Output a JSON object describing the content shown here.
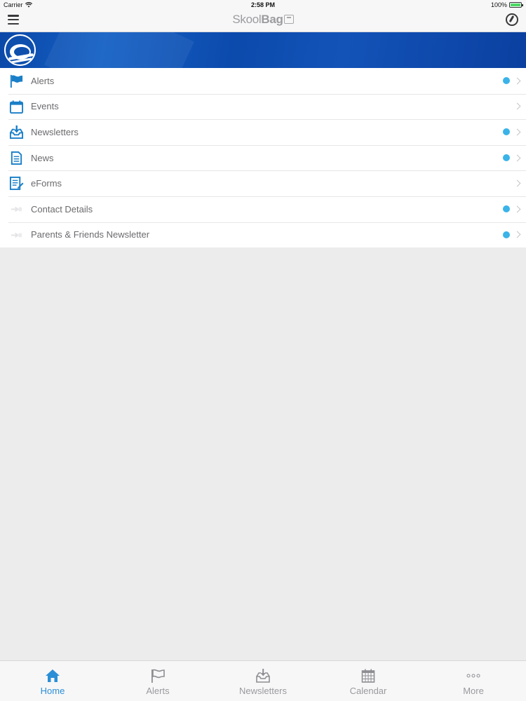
{
  "status_bar": {
    "carrier": "Carrier",
    "time": "2:58 PM",
    "battery": "100%",
    "battery_level": 1.0
  },
  "navbar": {
    "brand_light": "Skool",
    "brand_bold": "Bag"
  },
  "menu": {
    "items": [
      {
        "label": "Alerts",
        "icon": "flag-icon",
        "unread": true
      },
      {
        "label": "Events",
        "icon": "calendar-icon",
        "unread": false
      },
      {
        "label": "Newsletters",
        "icon": "inbox-download-icon",
        "unread": true
      },
      {
        "label": "News",
        "icon": "document-icon",
        "unread": true
      },
      {
        "label": "eForms",
        "icon": "form-pencil-icon",
        "unread": false
      },
      {
        "label": "Contact Details",
        "icon": "link-icon",
        "unread": true
      },
      {
        "label": "Parents & Friends Newsletter",
        "icon": "link-icon",
        "unread": true
      }
    ]
  },
  "tabbar": {
    "tabs": [
      {
        "label": "Home",
        "icon": "home-icon",
        "active": true
      },
      {
        "label": "Alerts",
        "icon": "flag-icon",
        "active": false
      },
      {
        "label": "Newsletters",
        "icon": "inbox-download-icon",
        "active": false
      },
      {
        "label": "Calendar",
        "icon": "calendar-grid-icon",
        "active": false
      },
      {
        "label": "More",
        "icon": "more-dots-icon",
        "active": false
      }
    ]
  },
  "colors": {
    "accent": "#2a8fd6",
    "unread_dot": "#3ab3e8",
    "banner": "#0c4aac",
    "icon_blue": "#1a7fc8"
  }
}
